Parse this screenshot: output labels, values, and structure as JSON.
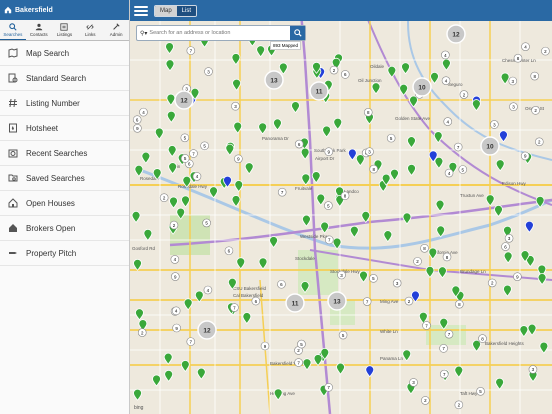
{
  "app": {
    "title": "Bakersfield"
  },
  "tabs": [
    {
      "label": "Searches",
      "icon": "searches-icon",
      "active": true
    },
    {
      "label": "Contacts",
      "icon": "contacts-icon",
      "active": false
    },
    {
      "label": "Listings",
      "icon": "listings-icon",
      "active": false
    },
    {
      "label": "Links",
      "icon": "links-icon",
      "active": false
    },
    {
      "label": "Admin",
      "icon": "admin-icon",
      "active": false
    }
  ],
  "menu": [
    {
      "label": "Map Search",
      "icon": "map-icon"
    },
    {
      "label": "Standard Search",
      "icon": "search-list-icon"
    },
    {
      "label": "Listing Number",
      "icon": "hash-icon"
    },
    {
      "label": "Hotsheet",
      "icon": "flame-icon"
    },
    {
      "label": "Recent Searches",
      "icon": "recent-icon"
    },
    {
      "label": "Saved Searches",
      "icon": "folder-icon"
    },
    {
      "label": "Open Houses",
      "icon": "house-icon"
    },
    {
      "label": "Brokers Open",
      "icon": "broker-house-icon"
    },
    {
      "label": "Property Pitch",
      "icon": "pitch-icon"
    }
  ],
  "view_toggle": {
    "map": "Map",
    "list": "List",
    "selected": "Map"
  },
  "search": {
    "placeholder": "Search for an address or location"
  },
  "mapped_count": "893 Mapped",
  "attribution": "bing",
  "clusters": [
    "12",
    "13",
    "11",
    "10",
    "10",
    "12",
    "11",
    "13",
    "12"
  ],
  "map_labels": [
    "Oil Junction",
    "Seguro",
    "Chess Center Ln",
    "Panorama Dr",
    "Fruitvale",
    "Landco",
    "Rosedale Hwy",
    "Westside Pkwy",
    "Stockdale Hwy",
    "Ming Ave",
    "White Ln",
    "Truxtun Ave",
    "California Ave",
    "Brundage Ln",
    "Oswell St",
    "Edison Hwy",
    "Golden State Ave",
    "Airport Dr",
    "South Oak Park",
    "Stockdale",
    "Gosford Rd",
    "Taft Hwy",
    "Panama Ln",
    "Hosking Ave",
    "CSU Bakersfield",
    "Bakersfield Valley",
    "Oildale",
    "Rosedale",
    "Cal Bakersfield",
    "Bakersfield Heights",
    "Arvin"
  ],
  "colors": {
    "brand": "#2a69a4",
    "pin_green": "#3aa83a",
    "pin_gray": "#9a9a9a",
    "pin_blue": "#2340d8"
  }
}
